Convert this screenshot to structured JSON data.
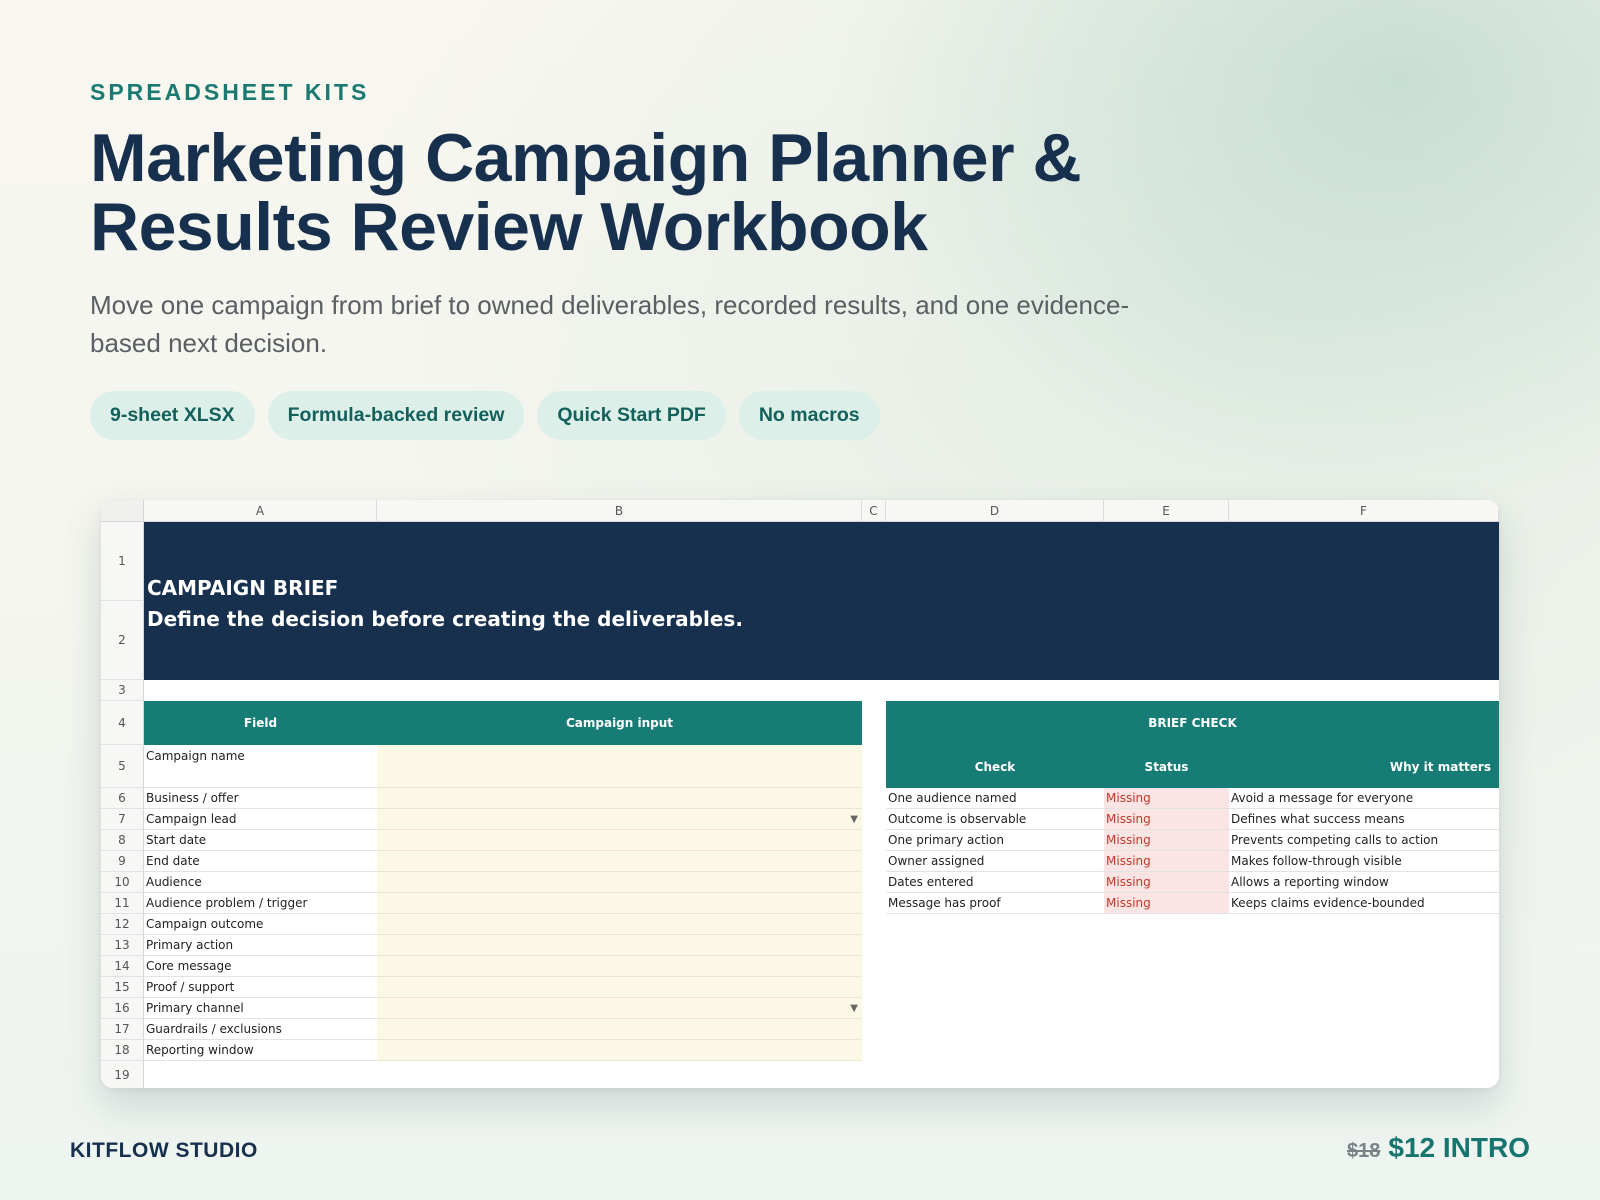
{
  "eyebrow": "SPREADSHEET KITS",
  "title_line1": "Marketing Campaign Planner &",
  "title_line2": "Results Review Workbook",
  "subtitle": "Move one campaign from brief to owned deliverables, recorded results, and one evidence-based next decision.",
  "pills": [
    "9-sheet XLSX",
    "Formula-backed review",
    "Quick Start PDF",
    "No macros"
  ],
  "sheet": {
    "columns": [
      "A",
      "B",
      "C",
      "D",
      "E",
      "F"
    ],
    "rows": [
      "1",
      "2",
      "3",
      "4",
      "5",
      "6",
      "7",
      "8",
      "9",
      "10",
      "11",
      "12",
      "13",
      "14",
      "15",
      "16",
      "17",
      "18",
      "19"
    ],
    "banner_title": "CAMPAIGN BRIEF",
    "banner_subtitle": "Define the decision before creating the deliverables.",
    "field_header": "Field",
    "input_header": "Campaign input",
    "fields": [
      "Campaign name",
      "Business / offer",
      "Campaign lead",
      "Start date",
      "End date",
      "Audience",
      "Audience problem / trigger",
      "Campaign outcome",
      "Primary action",
      "Core message",
      "Proof / support",
      "Primary channel",
      "Guardrails / exclusions",
      "Reporting window"
    ],
    "dropdown_icon": "chevron-down-icon",
    "brief_check": {
      "title": "BRIEF CHECK",
      "headers": [
        "Check",
        "Status",
        "Why it matters"
      ],
      "rows": [
        {
          "check": "One audience named",
          "status": "Missing",
          "why": "Avoid a message for everyone"
        },
        {
          "check": "Outcome is observable",
          "status": "Missing",
          "why": "Defines what success means"
        },
        {
          "check": "One primary action",
          "status": "Missing",
          "why": "Prevents competing calls to action"
        },
        {
          "check": "Owner assigned",
          "status": "Missing",
          "why": "Makes follow-through visible"
        },
        {
          "check": "Dates entered",
          "status": "Missing",
          "why": "Allows a reporting window"
        },
        {
          "check": "Message has proof",
          "status": "Missing",
          "why": "Keeps claims evidence-bounded"
        }
      ]
    }
  },
  "footer": {
    "brand": "KITFLOW STUDIO",
    "old_price": "$18",
    "new_price": "$12 INTRO"
  },
  "colors": {
    "navy": "#17304d",
    "teal": "#177c76",
    "input_fill": "#fcf8e6",
    "missing_fill": "#fbe4e4",
    "missing_text": "#c0392b"
  }
}
